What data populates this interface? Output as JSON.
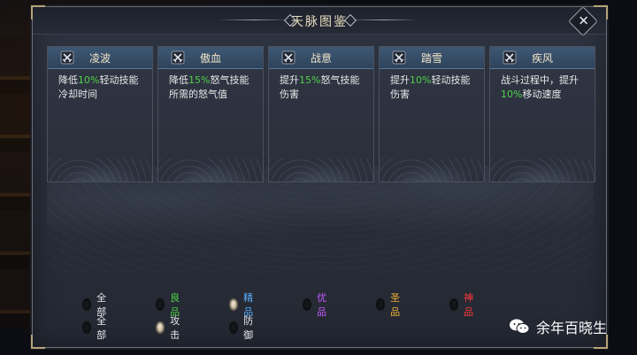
{
  "dialog": {
    "title": "天脉图鉴",
    "close_icon": "close-icon"
  },
  "cards": [
    {
      "name": "凌波",
      "desc_parts": [
        "降低",
        "10%",
        "轻动技能冷却时间"
      ],
      "icon": "crossed-swords-icon"
    },
    {
      "name": "傲血",
      "desc_parts": [
        "降低",
        "15%",
        "怒气技能所需的怒气值"
      ],
      "icon": "crossed-swords-icon"
    },
    {
      "name": "战意",
      "desc_parts": [
        "提升",
        "15%",
        "怒气技能伤害"
      ],
      "icon": "crossed-swords-icon"
    },
    {
      "name": "踏雪",
      "desc_parts": [
        "提升",
        "10%",
        "轻动技能伤害"
      ],
      "icon": "crossed-swords-icon"
    },
    {
      "name": "疾风",
      "desc_parts": [
        "战斗过程中，提升",
        "10%",
        "移动速度"
      ],
      "icon": "crossed-swords-icon"
    }
  ],
  "filters": {
    "quality": [
      {
        "label": "全部",
        "color": "#e8e8ea",
        "selected": false
      },
      {
        "label": "良品",
        "color": "#52d14a",
        "selected": false
      },
      {
        "label": "精品",
        "color": "#5ab0ff",
        "selected": true
      },
      {
        "label": "优品",
        "color": "#c65cff",
        "selected": false
      },
      {
        "label": "圣品",
        "color": "#f2b233",
        "selected": false
      },
      {
        "label": "神品",
        "color": "#ff3a3a",
        "selected": false
      }
    ],
    "type": [
      {
        "label": "全部",
        "color": "#e8e8ea",
        "selected": false
      },
      {
        "label": "攻击",
        "color": "#e8e8ea",
        "selected": true
      },
      {
        "label": "防御",
        "color": "#e8e8ea",
        "selected": false
      }
    ]
  },
  "watermark": {
    "text": "余年百晓生",
    "icon": "wechat-icon"
  }
}
